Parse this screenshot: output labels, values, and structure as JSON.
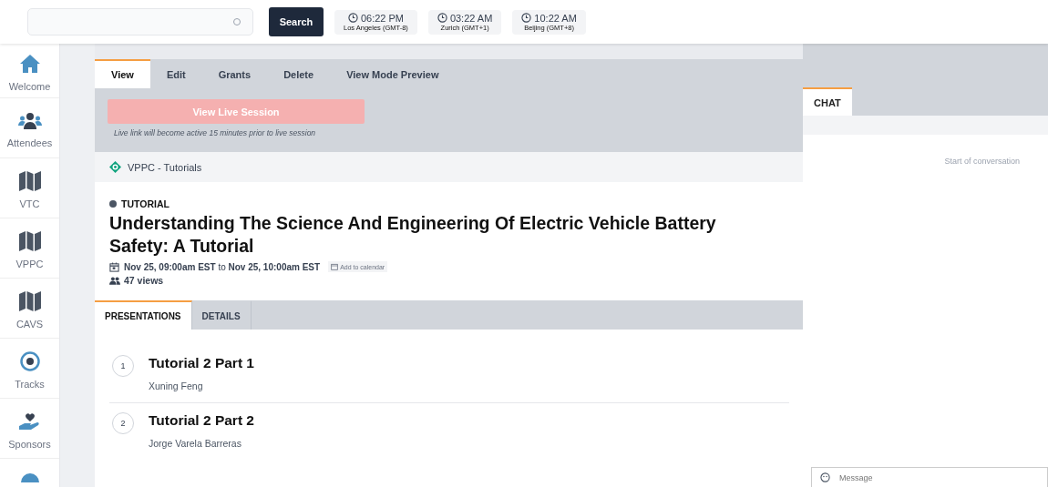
{
  "topbar": {
    "search_button": "Search",
    "clocks": [
      {
        "time": "06:22 PM",
        "zone": "Los Angeles (GMT-8)"
      },
      {
        "time": "03:22 AM",
        "zone": "Zurich (GMT+1)"
      },
      {
        "time": "10:22 AM",
        "zone": "Beijing (GMT+8)"
      }
    ]
  },
  "sidebar": {
    "items": [
      {
        "kind": "home",
        "label": "Welcome"
      },
      {
        "kind": "people",
        "label": "Attendees"
      },
      {
        "kind": "map",
        "label": "VTC"
      },
      {
        "kind": "map",
        "label": "VPPC"
      },
      {
        "kind": "map",
        "label": "CAVS"
      },
      {
        "kind": "target",
        "label": "Tracks"
      },
      {
        "kind": "hand",
        "label": "Sponsors"
      },
      {
        "kind": "help"
      }
    ]
  },
  "action_tabs": [
    {
      "label": "View",
      "selected": true
    },
    {
      "label": "Edit",
      "selected": false
    },
    {
      "label": "Grants",
      "selected": false
    },
    {
      "label": "Delete",
      "selected": false
    },
    {
      "label": "View Mode Preview",
      "selected": false
    }
  ],
  "live_session": {
    "button": "View Live Session",
    "disabled": true,
    "note": "Live link will become active 15 minutes prior to live session"
  },
  "breadcrumb": "VPPC - Tutorials",
  "event": {
    "tag": "TUTORIAL",
    "title": "Understanding The Science And Engineering Of Electric Vehicle Battery Safety: A Tutorial",
    "start": "Nov 25, 09:00am EST",
    "to": "to",
    "end": "Nov 25, 10:00am EST",
    "add_to_calendar": "Add to calendar",
    "views": "47 views"
  },
  "content_tabs": [
    {
      "label": "PRESENTATIONS",
      "selected": true
    },
    {
      "label": "DETAILS",
      "selected": false
    }
  ],
  "presentations": [
    {
      "number": "1",
      "title": "Tutorial 2 Part 1",
      "speaker": "Xuning Feng"
    },
    {
      "number": "2",
      "title": "Tutorial 2 Part 2",
      "speaker": "Jorge Varela Barreras"
    }
  ],
  "chat": {
    "tabs": [
      {
        "label": "CHAT",
        "selected": true
      }
    ],
    "start": "Start of conversation",
    "placeholder": "Message"
  }
}
